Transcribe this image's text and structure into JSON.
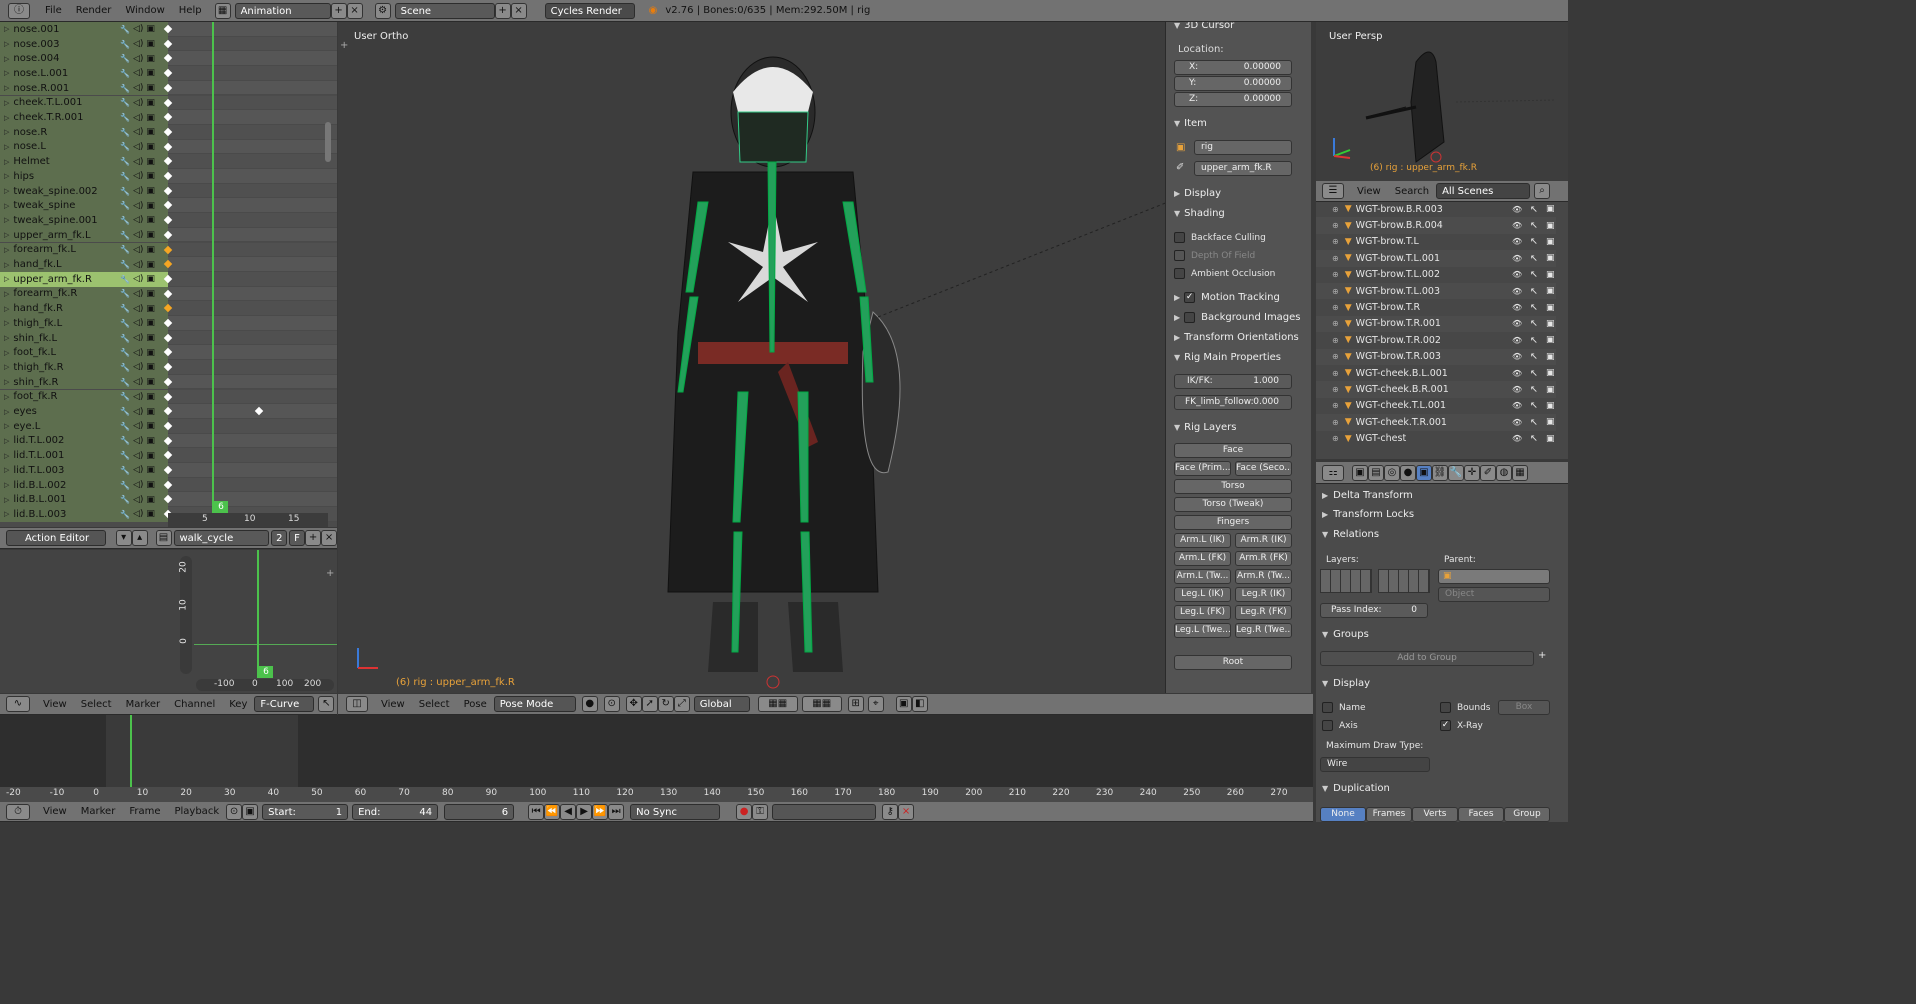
{
  "topbar": {
    "menus": [
      "File",
      "Render",
      "Window",
      "Help"
    ],
    "layout": "Animation",
    "scene": "Scene",
    "engine": "Cycles Render",
    "info": "v2.76 | Bones:0/635 | Mem:292.50M | rig"
  },
  "dopesheet": {
    "channels": [
      {
        "name": "nose.001",
        "sel": false,
        "key": "w"
      },
      {
        "name": "nose.003",
        "sel": false,
        "key": "w"
      },
      {
        "name": "nose.004",
        "sel": false,
        "key": "w"
      },
      {
        "name": "nose.L.001",
        "sel": false,
        "key": "w"
      },
      {
        "name": "nose.R.001",
        "sel": false,
        "key": "w"
      },
      {
        "name": "cheek.T.L.001",
        "sel": false,
        "key": "w"
      },
      {
        "name": "cheek.T.R.001",
        "sel": false,
        "key": "w"
      },
      {
        "name": "nose.R",
        "sel": false,
        "key": "w"
      },
      {
        "name": "nose.L",
        "sel": false,
        "key": "w"
      },
      {
        "name": "Helmet",
        "sel": false,
        "key": "w"
      },
      {
        "name": "hips",
        "sel": false,
        "key": "w"
      },
      {
        "name": "tweak_spine.002",
        "sel": false,
        "key": "w"
      },
      {
        "name": "tweak_spine",
        "sel": false,
        "key": "w"
      },
      {
        "name": "tweak_spine.001",
        "sel": false,
        "key": "w"
      },
      {
        "name": "upper_arm_fk.L",
        "sel": false,
        "key": "w"
      },
      {
        "name": "forearm_fk.L",
        "sel": false,
        "key": "o"
      },
      {
        "name": "hand_fk.L",
        "sel": false,
        "key": "o"
      },
      {
        "name": "upper_arm_fk.R",
        "sel": true,
        "key": "w"
      },
      {
        "name": "forearm_fk.R",
        "sel": false,
        "key": "w"
      },
      {
        "name": "hand_fk.R",
        "sel": false,
        "key": "o"
      },
      {
        "name": "thigh_fk.L",
        "sel": false,
        "key": "w"
      },
      {
        "name": "shin_fk.L",
        "sel": false,
        "key": "w"
      },
      {
        "name": "foot_fk.L",
        "sel": false,
        "key": "w"
      },
      {
        "name": "thigh_fk.R",
        "sel": false,
        "key": "w"
      },
      {
        "name": "shin_fk.R",
        "sel": false,
        "key": "w"
      },
      {
        "name": "foot_fk.R",
        "sel": false,
        "key": "w"
      },
      {
        "name": "eyes",
        "sel": false,
        "key": "w"
      },
      {
        "name": "eye.L",
        "sel": false,
        "key": "w"
      },
      {
        "name": "lid.T.L.002",
        "sel": false,
        "key": "w"
      },
      {
        "name": "lid.T.L.001",
        "sel": false,
        "key": "w"
      },
      {
        "name": "lid.T.L.003",
        "sel": false,
        "key": "w"
      },
      {
        "name": "lid.B.L.002",
        "sel": false,
        "key": "w"
      },
      {
        "name": "lid.B.L.001",
        "sel": false,
        "key": "w"
      },
      {
        "name": "lid.B.L.003",
        "sel": false,
        "key": "w"
      }
    ],
    "ruler": [
      "5",
      "10",
      "15"
    ],
    "frame": "6"
  },
  "action_editor": {
    "mode": "Action Editor",
    "action": "walk_cycle",
    "users": "2",
    "fake": "F"
  },
  "graph": {
    "y_ticks": [
      "20",
      "10",
      "0"
    ],
    "x_ticks": [
      "-100",
      "0",
      "100",
      "200"
    ],
    "frame": "6",
    "menus": [
      "View",
      "Select",
      "Marker",
      "Channel",
      "Key"
    ],
    "mode": "F-Curve"
  },
  "viewport": {
    "label": "User Ortho",
    "status": "(6) rig : upper_arm_fk.R",
    "menus": [
      "View",
      "Select",
      "Pose"
    ],
    "mode": "Pose Mode",
    "orientation": "Global"
  },
  "npanel": {
    "cursor_title": "3D Cursor",
    "location_label": "Location:",
    "x": "X:",
    "xv": "0.00000",
    "y": "Y:",
    "yv": "0.00000",
    "z": "Z:",
    "zv": "0.00000",
    "item": "Item",
    "obj": "rig",
    "bone": "upper_arm_fk.R",
    "display": "Display",
    "shading": "Shading",
    "backface": "Backface Culling",
    "dof": "Depth Of Field",
    "ao": "Ambient Occlusion",
    "motion": "Motion Tracking",
    "bg": "Background Images",
    "transform": "Transform Orientations",
    "rigmain": "Rig Main Properties",
    "ikfk": "IK/FK:",
    "ikfk_v": "1.000",
    "fkl": "FK_limb_follow:",
    "fkl_v": "0.000",
    "riglayers": "Rig Layers",
    "layers": [
      "Face",
      "Face (Prim...",
      "Face (Seco...",
      "Torso",
      "Torso (Tweak)",
      "Fingers",
      "Arm.L (IK)",
      "Arm.R (IK)",
      "Arm.L (FK)",
      "Arm.R (FK)",
      "Arm.L (Tw...",
      "Arm.R (Tw...",
      "Leg.L (IK)",
      "Leg.R (IK)",
      "Leg.L (FK)",
      "Leg.R (FK)",
      "Leg.L (Twe...",
      "Leg.R (Twe...",
      "Root"
    ]
  },
  "preview": {
    "label": "User Persp",
    "status": "(6) rig : upper_arm_fk.R"
  },
  "outliner": {
    "menus": [
      "View",
      "Search"
    ],
    "scope": "All Scenes",
    "items": [
      "WGT-brow.B.R.003",
      "WGT-brow.B.R.004",
      "WGT-brow.T.L",
      "WGT-brow.T.L.001",
      "WGT-brow.T.L.002",
      "WGT-brow.T.L.003",
      "WGT-brow.T.R",
      "WGT-brow.T.R.001",
      "WGT-brow.T.R.002",
      "WGT-brow.T.R.003",
      "WGT-cheek.B.L.001",
      "WGT-cheek.B.R.001",
      "WGT-cheek.T.L.001",
      "WGT-cheek.T.R.001",
      "WGT-chest"
    ]
  },
  "props": {
    "delta": "Delta Transform",
    "locks": "Transform Locks",
    "relations": "Relations",
    "layers": "Layers:",
    "parent": "Parent:",
    "object_ph": "Object",
    "pass": "Pass Index:",
    "pass_v": "0",
    "groups": "Groups",
    "add_group": "Add to Group",
    "display": "Display",
    "name": "Name",
    "bounds": "Bounds",
    "box": "Box",
    "axis": "Axis",
    "xray": "X-Ray",
    "maxdraw": "Maximum Draw Type:",
    "wire": "Wire",
    "duplication": "Duplication",
    "dup": [
      "None",
      "Frames",
      "Verts",
      "Faces",
      "Group"
    ]
  },
  "timeline": {
    "ticks": [
      "-20",
      "-10",
      "0",
      "10",
      "20",
      "30",
      "40",
      "50",
      "60",
      "70",
      "80",
      "90",
      "100",
      "110",
      "120",
      "130",
      "140",
      "150",
      "160",
      "170",
      "180",
      "190",
      "200",
      "210",
      "220",
      "230",
      "240",
      "250",
      "260",
      "270"
    ],
    "menus": [
      "View",
      "Marker",
      "Frame",
      "Playback"
    ],
    "start_label": "Start:",
    "start": "1",
    "end_label": "End:",
    "end": "44",
    "current": "6",
    "sync": "No Sync"
  }
}
